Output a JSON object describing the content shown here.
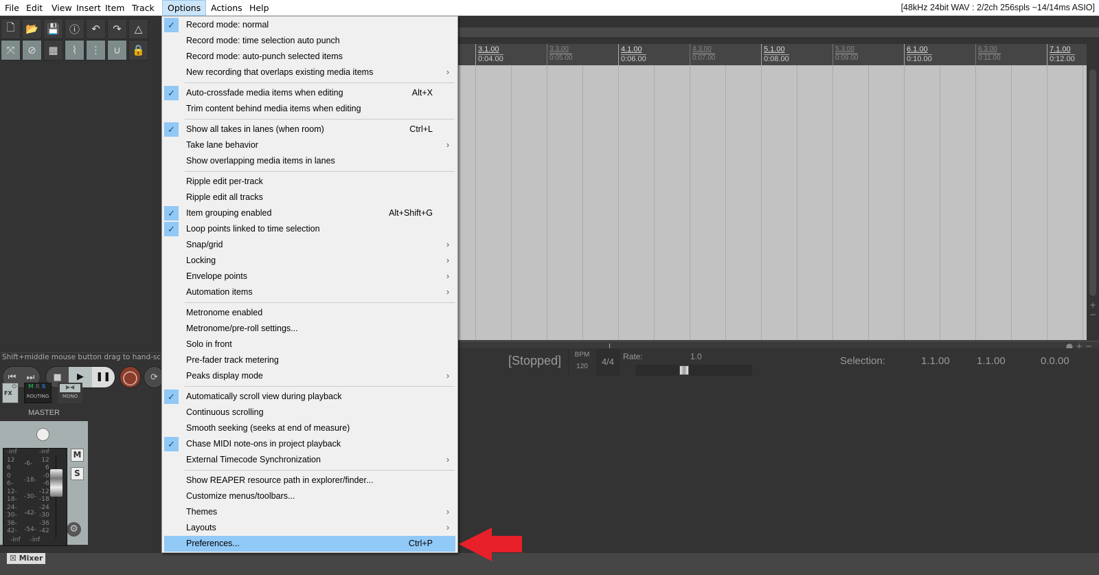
{
  "menubar": {
    "items": [
      "File",
      "Edit",
      "View",
      "Insert",
      "Item",
      "Track",
      "Options",
      "Actions",
      "Help"
    ],
    "active": "Options",
    "status": "[48kHz 24bit WAV : 2/2ch 256spls ~14/14ms ASIO]"
  },
  "hint": "Shift+middle mouse button drag to hand-scroll the view",
  "ruler": {
    "major": [
      {
        "bar": "3.1.00",
        "time": "0:04.00"
      },
      {
        "bar": "4.1.00",
        "time": "0:06.00"
      },
      {
        "bar": "5.1.00",
        "time": "0:08.00"
      },
      {
        "bar": "6.1.00",
        "time": "0:10.00"
      },
      {
        "bar": "7.1.00",
        "time": "0:12.00"
      }
    ],
    "minor": [
      {
        "bar": "3.3.00",
        "time": "0:05.00"
      },
      {
        "bar": "4.3.00",
        "time": "0:07.00"
      },
      {
        "bar": "5.3.00",
        "time": "0:09.00"
      },
      {
        "bar": "6.3.00",
        "time": "0:11.00"
      }
    ]
  },
  "transport": {
    "state": "[Stopped]",
    "bpm_label": "BPM",
    "bpm": "120",
    "timesig": "4/4",
    "rate_label": "Rate:",
    "rate": "1.0",
    "selection_label": "Selection:",
    "sel_start": "1.1.00",
    "sel_end": "1.1.00",
    "sel_length": "0.0.00"
  },
  "master": {
    "label": "MASTER",
    "fx": "FX",
    "routing": "ROUTING",
    "mono": "MONO",
    "mute": "M",
    "solo": "S",
    "routing_flags": [
      "M",
      "R",
      "S"
    ],
    "meter_left": [
      "-inf",
      "12",
      "6",
      "0",
      "6-",
      "12-",
      "18-",
      "24-",
      "30-",
      "36-",
      "42-"
    ],
    "meter_mid": [
      "-6-",
      "-18-",
      "-30-",
      "-42-",
      "-54-"
    ],
    "meter_right": [
      "-inf",
      "12",
      "6",
      "-0",
      "-6",
      "-12",
      "-18",
      "-24",
      "-30",
      "-36",
      "-42"
    ],
    "meter_bottom": [
      "-inf",
      "-inf"
    ]
  },
  "bottom": {
    "mixer_tab": "Mixer"
  },
  "menu": {
    "groups": [
      [
        {
          "label": "Record mode: normal",
          "checked": true
        },
        {
          "label": "Record mode: time selection auto punch"
        },
        {
          "label": "Record mode: auto-punch selected items"
        },
        {
          "label": "New recording that overlaps existing media items",
          "submenu": true
        }
      ],
      [
        {
          "label": "Auto-crossfade media items when editing",
          "checked": true,
          "shortcut": "Alt+X"
        },
        {
          "label": "Trim content behind media items when editing"
        }
      ],
      [
        {
          "label": "Show all takes in lanes (when room)",
          "checked": true,
          "shortcut": "Ctrl+L"
        },
        {
          "label": "Take lane behavior",
          "submenu": true
        },
        {
          "label": "Show overlapping media items in lanes"
        }
      ],
      [
        {
          "label": "Ripple edit per-track"
        },
        {
          "label": "Ripple edit all tracks"
        },
        {
          "label": "Item grouping enabled",
          "checked": true,
          "shortcut": "Alt+Shift+G"
        },
        {
          "label": "Loop points linked to time selection",
          "checked": true
        },
        {
          "label": "Snap/grid",
          "submenu": true
        },
        {
          "label": "Locking",
          "submenu": true
        },
        {
          "label": "Envelope points",
          "submenu": true
        },
        {
          "label": "Automation items",
          "submenu": true
        }
      ],
      [
        {
          "label": "Metronome enabled"
        },
        {
          "label": "Metronome/pre-roll settings..."
        },
        {
          "label": "Solo in front"
        },
        {
          "label": "Pre-fader track metering"
        },
        {
          "label": "Peaks display mode",
          "submenu": true
        }
      ],
      [
        {
          "label": "Automatically scroll view during playback",
          "checked": true
        },
        {
          "label": "Continuous scrolling"
        },
        {
          "label": "Smooth seeking (seeks at end of measure)"
        },
        {
          "label": "Chase MIDI note-ons in project playback",
          "checked": true
        },
        {
          "label": "External Timecode Synchronization",
          "submenu": true
        }
      ],
      [
        {
          "label": "Show REAPER resource path in explorer/finder..."
        },
        {
          "label": "Customize menus/toolbars..."
        },
        {
          "label": "Themes",
          "submenu": true
        },
        {
          "label": "Layouts",
          "submenu": true
        },
        {
          "label": "Preferences...",
          "shortcut": "Ctrl+P",
          "highlighted": true
        }
      ]
    ]
  },
  "colors": {
    "highlight": "#91c9f7",
    "annotation_arrow": "#e8202a",
    "track_bg": "#c2c2c2"
  },
  "toolbar": {
    "icons": [
      "new-project-icon",
      "open-project-icon",
      "save-project-icon",
      "project-info-icon",
      "undo-icon",
      "redo-icon",
      "metronome-icon",
      "auto-crossfade-icon",
      "ripple-edit-icon",
      "item-grouping-icon",
      "envelope-points-icon",
      "grid-icon",
      "snap-icon",
      "lock-icon"
    ]
  }
}
